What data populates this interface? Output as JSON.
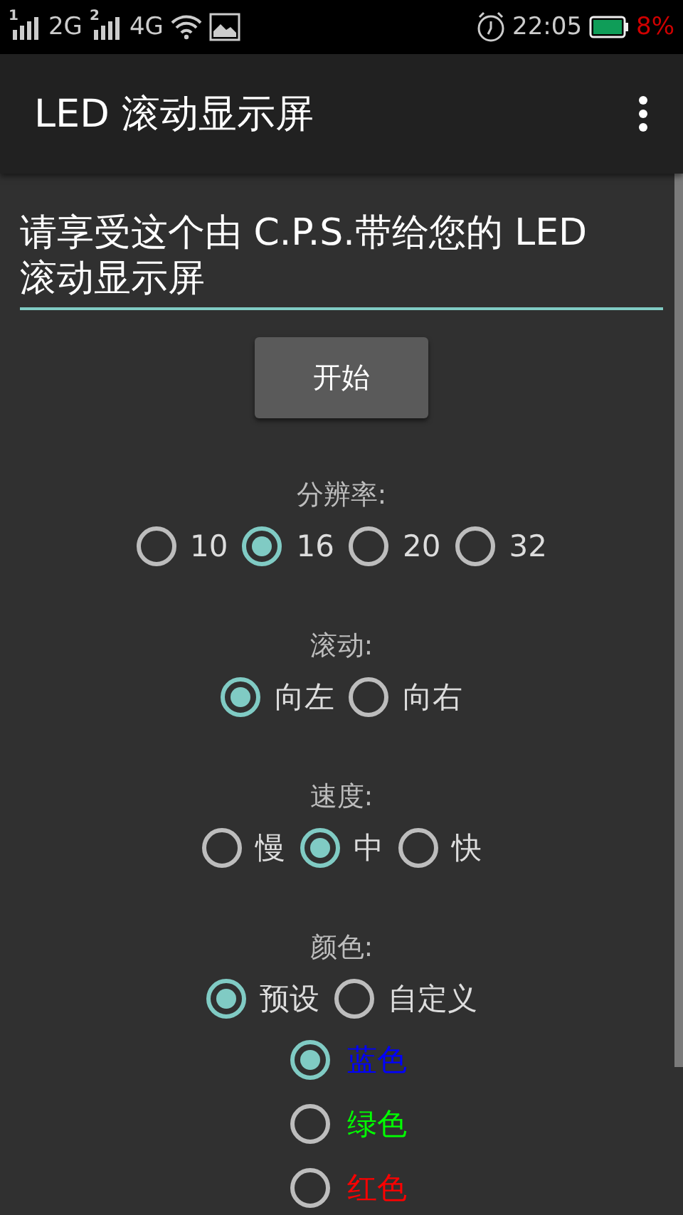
{
  "status_bar": {
    "sim_1": "1",
    "network_1": "2G",
    "sim_2": "2",
    "network_2": "4G",
    "time": "22:05",
    "battery": "8%"
  },
  "app_bar": {
    "title": "LED 滚动显示屏"
  },
  "message_field": {
    "value": "请享受这个由 C.P.S.带给您的 LED 滚动显示屏"
  },
  "start_button": {
    "label": "开始"
  },
  "groups": [
    {
      "label": "分辨率:",
      "options": [
        {
          "label": "10",
          "selected": false
        },
        {
          "label": "16",
          "selected": true
        },
        {
          "label": "20",
          "selected": false
        },
        {
          "label": "32",
          "selected": false
        }
      ]
    },
    {
      "label": "滚动:",
      "options": [
        {
          "label": "向左",
          "selected": true
        },
        {
          "label": "向右",
          "selected": false
        }
      ]
    },
    {
      "label": "速度:",
      "options": [
        {
          "label": "慢",
          "selected": false
        },
        {
          "label": "中",
          "selected": true
        },
        {
          "label": "快",
          "selected": false
        }
      ]
    },
    {
      "label": "颜色:",
      "options": [
        {
          "label": "预设",
          "selected": true
        },
        {
          "label": "自定义",
          "selected": false
        }
      ]
    }
  ],
  "colors": [
    {
      "label": "蓝色",
      "color": "#0000ff",
      "selected": true
    },
    {
      "label": "绿色",
      "color": "#00ff00",
      "selected": false
    },
    {
      "label": "红色",
      "color": "#ff0000",
      "selected": false
    }
  ]
}
